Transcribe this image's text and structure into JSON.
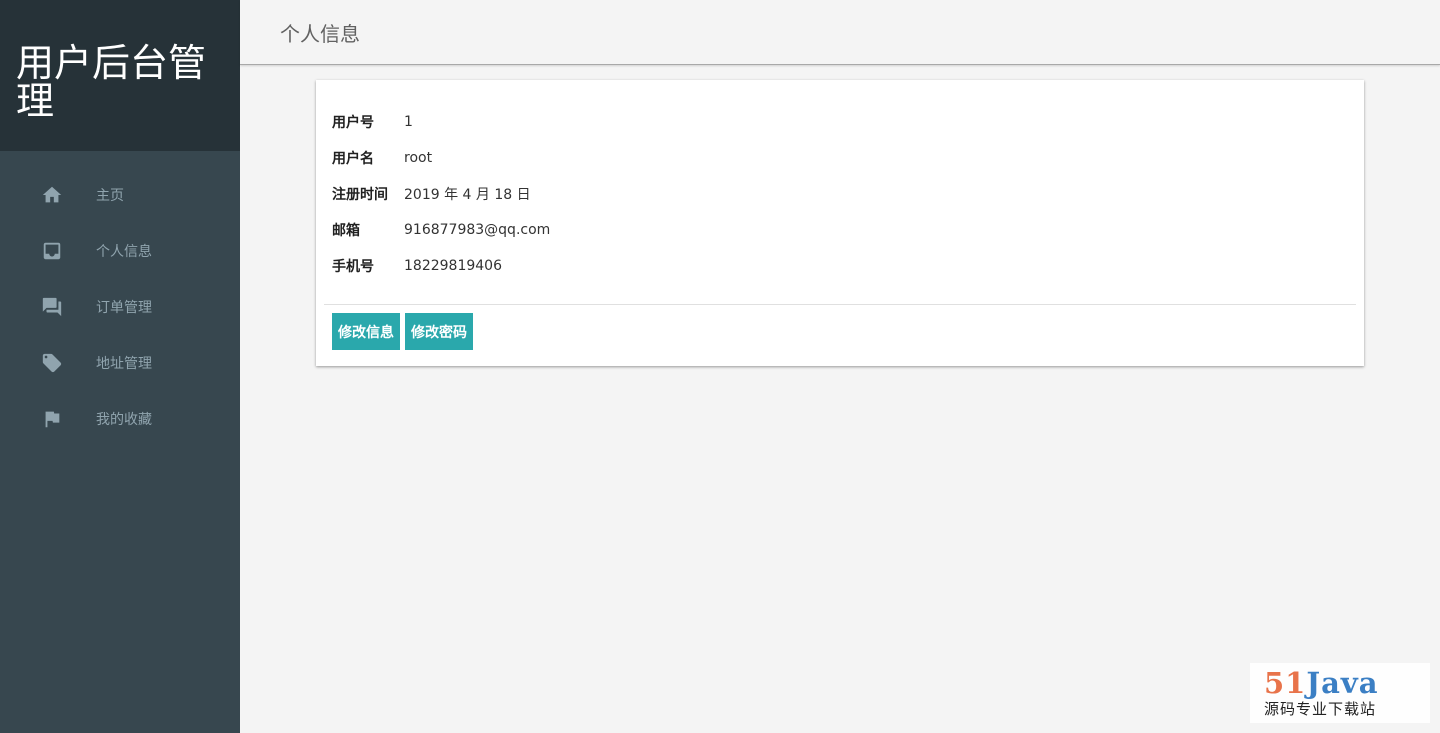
{
  "sidebar": {
    "brand": "用户后台管理",
    "items": [
      {
        "label": "主页",
        "icon": "home-icon"
      },
      {
        "label": "个人信息",
        "icon": "inbox-icon"
      },
      {
        "label": "订单管理",
        "icon": "forum-icon"
      },
      {
        "label": "地址管理",
        "icon": "tag-icon"
      },
      {
        "label": "我的收藏",
        "icon": "flag-icon"
      }
    ]
  },
  "header": {
    "title": "个人信息"
  },
  "profile": {
    "fields": [
      {
        "label": "用户号",
        "value": "1"
      },
      {
        "label": "用户名",
        "value": "root"
      },
      {
        "label": "注册时间",
        "value": "2019 年 4 月 18 日"
      },
      {
        "label": "邮箱",
        "value": "916877983@qq.com"
      },
      {
        "label": "手机号",
        "value": "18229819406"
      }
    ],
    "edit_info_label": "修改信息",
    "change_password_label": "修改密码"
  },
  "watermark": {
    "logo_number": "51",
    "logo_word": "Java",
    "subtitle": "源码专业下载站"
  },
  "colors": {
    "sidebar_bg": "#37474f",
    "brand_bg": "#263238",
    "accent": "#2aa8ac",
    "page_bg": "#f4f4f4"
  }
}
